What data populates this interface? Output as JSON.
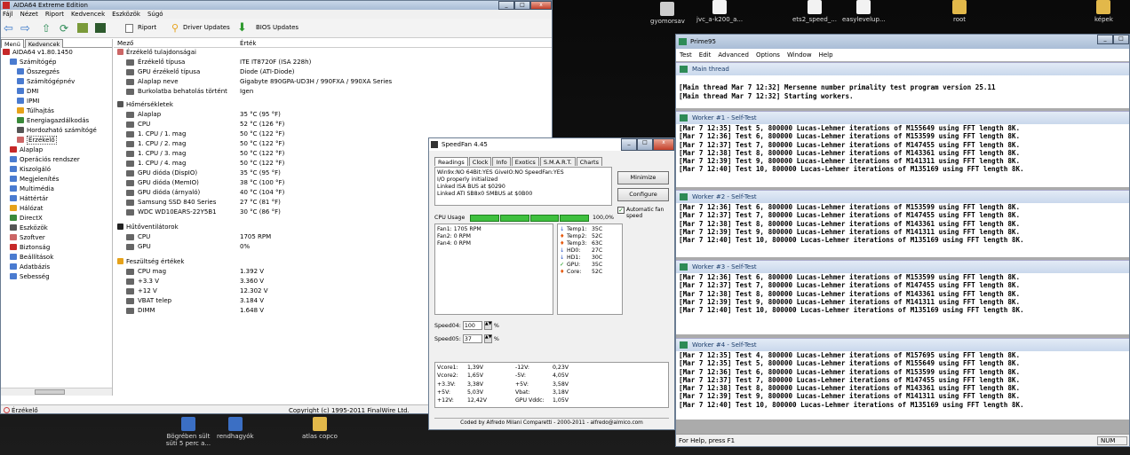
{
  "desktop": {
    "icons": [
      {
        "label": "gyomorsav",
        "icon": "app-icon"
      },
      {
        "label": "jvc_a-k200_a...",
        "icon": "document-icon"
      },
      {
        "label": "ets2_speed_...",
        "icon": "document-icon"
      },
      {
        "label": "easylevelup...",
        "icon": "document-icon"
      },
      {
        "label": "root",
        "icon": "folder-icon"
      },
      {
        "label": "képek",
        "icon": "folder-icon"
      },
      {
        "label": "Bögrében sült süti 5 perc a...",
        "icon": "word-icon"
      },
      {
        "label": "rendhagyók",
        "icon": "word-icon"
      },
      {
        "label": "atlas copco",
        "icon": "folder-icon"
      }
    ]
  },
  "aida": {
    "title": "AIDA64 Extreme Edition",
    "menu": [
      "Fájl",
      "Nézet",
      "Riport",
      "Kedvencek",
      "Eszközök",
      "Súgó"
    ],
    "toolbar": {
      "report": "Riport",
      "driver": "Driver Updates",
      "bios": "BIOS Updates"
    },
    "left_tabs": [
      "Menü",
      "Kedvencek"
    ],
    "tree": [
      {
        "label": "AIDA64 v1.80.1450",
        "level": 0
      },
      {
        "label": "Számítógép",
        "level": 1
      },
      {
        "label": "Összegzés",
        "level": 2
      },
      {
        "label": "Számítógépnév",
        "level": 2
      },
      {
        "label": "DMI",
        "level": 2
      },
      {
        "label": "IPMI",
        "level": 2
      },
      {
        "label": "Túlhajtás",
        "level": 2
      },
      {
        "label": "Energiagazdálkodás",
        "level": 2
      },
      {
        "label": "Hordozható számítógé",
        "level": 2
      },
      {
        "label": "Érzékelő",
        "level": 2
      },
      {
        "label": "Alaplap",
        "level": 1
      },
      {
        "label": "Operációs rendszer",
        "level": 1
      },
      {
        "label": "Kiszolgáló",
        "level": 1
      },
      {
        "label": "Megjelenítés",
        "level": 1
      },
      {
        "label": "Multimédia",
        "level": 1
      },
      {
        "label": "Háttértár",
        "level": 1
      },
      {
        "label": "Hálózat",
        "level": 1
      },
      {
        "label": "DirectX",
        "level": 1
      },
      {
        "label": "Eszközök",
        "level": 1
      },
      {
        "label": "Szoftver",
        "level": 1
      },
      {
        "label": "Biztonság",
        "level": 1
      },
      {
        "label": "Beállítások",
        "level": 1
      },
      {
        "label": "Adatbázis",
        "level": 1
      },
      {
        "label": "Sebesség",
        "level": 1
      }
    ],
    "columns": [
      "Mező",
      "Érték"
    ],
    "sections": [
      {
        "title": "Érzékelő tulajdonságai",
        "rows": [
          [
            "Érzékelő típusa",
            "ITE IT8720F  (ISA 228h)"
          ],
          [
            "GPU érzékelő típusa",
            "Diode  (ATI-Diode)"
          ],
          [
            "Alaplap neve",
            "Gigabyte 890GPA-UD3H / 990FXA / 990XA Series"
          ],
          [
            "Burkolatba behatolás történt",
            "Igen"
          ]
        ]
      },
      {
        "title": "Hőmérsékletek",
        "rows": [
          [
            "Alaplap",
            "35 °C  (95 °F)"
          ],
          [
            "CPU",
            "52 °C  (126 °F)"
          ],
          [
            "1. CPU / 1. mag",
            "50 °C  (122 °F)"
          ],
          [
            "1. CPU / 2. mag",
            "50 °C  (122 °F)"
          ],
          [
            "1. CPU / 3. mag",
            "50 °C  (122 °F)"
          ],
          [
            "1. CPU / 4. mag",
            "50 °C  (122 °F)"
          ],
          [
            "GPU dióda (DispIO)",
            "35 °C  (95 °F)"
          ],
          [
            "GPU dióda (MemIO)",
            "38 °C  (100 °F)"
          ],
          [
            "GPU dióda (árnyaló)",
            "40 °C  (104 °F)"
          ],
          [
            "Samsung SSD 840 Series",
            "27 °C  (81 °F)"
          ],
          [
            "WDC WD10EARS-22Y5B1",
            "30 °C  (86 °F)"
          ]
        ]
      },
      {
        "title": "Hűtőventilátorok",
        "rows": [
          [
            "CPU",
            "1705 RPM"
          ],
          [
            "GPU",
            "0%"
          ]
        ]
      },
      {
        "title": "Feszültség értékek",
        "rows": [
          [
            "CPU mag",
            "1.392 V"
          ],
          [
            "+3.3 V",
            "3.360 V"
          ],
          [
            "+12 V",
            "12.302 V"
          ],
          [
            "VBAT telep",
            "3.184 V"
          ],
          [
            "DIMM",
            "1.648 V"
          ]
        ]
      }
    ],
    "status_left": "Érzékelő",
    "status_right": "Copyright (c) 1995-2011 FinalWire Ltd."
  },
  "speedfan": {
    "title": "SpeedFan 4.45",
    "tabs": [
      "Readings",
      "Clock",
      "Info",
      "Exotics",
      "S.M.A.R.T.",
      "Charts"
    ],
    "log": [
      "Win9x:NO  64Bit:YES  GiveIO:NO  SpeedFan:YES",
      "I/O properly initialized",
      "Linked ISA BUS at $0290",
      "Linked ATI SB8x0 SMBUS at $0B00"
    ],
    "buttons": {
      "minimize": "Minimize",
      "configure": "Configure"
    },
    "autofan": "Automatic fan speed",
    "cpu_usage_label": "CPU Usage",
    "cpu_usage_pct": "100,0%",
    "fans": [
      "Fan1: 1705 RPM",
      "Fan2: 0 RPM",
      "Fan4: 0 RPM"
    ],
    "temps": [
      {
        "label": "Temp1:",
        "value": "35C",
        "status": "down"
      },
      {
        "label": "Temp2:",
        "value": "52C",
        "status": "hot"
      },
      {
        "label": "Temp3:",
        "value": "63C",
        "status": "hot"
      },
      {
        "label": "HD0:",
        "value": "27C",
        "status": "down"
      },
      {
        "label": "HD1:",
        "value": "30C",
        "status": "down"
      },
      {
        "label": "GPU:",
        "value": "35C",
        "status": "ok"
      },
      {
        "label": "Core:",
        "value": "52C",
        "status": "hot"
      }
    ],
    "speeds": [
      {
        "label": "Speed04:",
        "value": "100",
        "unit": "%"
      },
      {
        "label": "Speed05:",
        "value": "37",
        "unit": "%"
      }
    ],
    "volts": [
      [
        "Vcore1:",
        "1,39V",
        "-12V:",
        "0,23V"
      ],
      [
        "Vcore2:",
        "1,65V",
        "-5V:",
        "4,05V"
      ],
      [
        "+3.3V:",
        "3,38V",
        "+5V:",
        "3,58V"
      ],
      [
        "+5V:",
        "5,03V",
        "Vbat:",
        "3,18V"
      ],
      [
        "+12V:",
        "12,42V",
        "GPU Vddc:",
        "1,05V"
      ]
    ],
    "footer": "Coded by Alfredo Milani Comparetti - 2000-2011 - alfredo@almico.com"
  },
  "prime": {
    "title": "Prime95",
    "menu": [
      "Test",
      "Edit",
      "Advanced",
      "Options",
      "Window",
      "Help"
    ],
    "panes": [
      {
        "title": "Main thread",
        "lines": [
          "",
          "[Main thread Mar 7 12:32] Mersenne number primality test program version 25.11",
          "[Main thread Mar 7 12:32] Starting workers."
        ]
      },
      {
        "title": "Worker #1 - Self-Test",
        "lines": [
          "[Mar 7 12:35] Test 5, 800000 Lucas-Lehmer iterations of M155649 using FFT length 8K.",
          "[Mar 7 12:36] Test 6, 800000 Lucas-Lehmer iterations of M153599 using FFT length 8K.",
          "[Mar 7 12:37] Test 7, 800000 Lucas-Lehmer iterations of M147455 using FFT length 8K.",
          "[Mar 7 12:38] Test 8, 800000 Lucas-Lehmer iterations of M143361 using FFT length 8K.",
          "[Mar 7 12:39] Test 9, 800000 Lucas-Lehmer iterations of M141311 using FFT length 8K.",
          "[Mar 7 12:40] Test 10, 800000 Lucas-Lehmer iterations of M135169 using FFT length 8K."
        ]
      },
      {
        "title": "Worker #2 - Self-Test",
        "lines": [
          "[Mar 7 12:36] Test 6, 800000 Lucas-Lehmer iterations of M153599 using FFT length 8K.",
          "[Mar 7 12:37] Test 7, 800000 Lucas-Lehmer iterations of M147455 using FFT length 8K.",
          "[Mar 7 12:38] Test 8, 800000 Lucas-Lehmer iterations of M143361 using FFT length 8K.",
          "[Mar 7 12:39] Test 9, 800000 Lucas-Lehmer iterations of M141311 using FFT length 8K.",
          "[Mar 7 12:40] Test 10, 800000 Lucas-Lehmer iterations of M135169 using FFT length 8K."
        ]
      },
      {
        "title": "Worker #3 - Self-Test",
        "lines": [
          "[Mar 7 12:36] Test 6, 800000 Lucas-Lehmer iterations of M153599 using FFT length 8K.",
          "[Mar 7 12:37] Test 7, 800000 Lucas-Lehmer iterations of M147455 using FFT length 8K.",
          "[Mar 7 12:38] Test 8, 800000 Lucas-Lehmer iterations of M143361 using FFT length 8K.",
          "[Mar 7 12:39] Test 9, 800000 Lucas-Lehmer iterations of M141311 using FFT length 8K.",
          "[Mar 7 12:40] Test 10, 800000 Lucas-Lehmer iterations of M135169 using FFT length 8K."
        ]
      },
      {
        "title": "Worker #4 - Self-Test",
        "lines": [
          "[Mar 7 12:35] Test 4, 800000 Lucas-Lehmer iterations of M157695 using FFT length 8K.",
          "[Mar 7 12:35] Test 5, 800000 Lucas-Lehmer iterations of M155649 using FFT length 8K.",
          "[Mar 7 12:36] Test 6, 800000 Lucas-Lehmer iterations of M153599 using FFT length 8K.",
          "[Mar 7 12:37] Test 7, 800000 Lucas-Lehmer iterations of M147455 using FFT length 8K.",
          "[Mar 7 12:38] Test 8, 800000 Lucas-Lehmer iterations of M143361 using FFT length 8K.",
          "[Mar 7 12:39] Test 9, 800000 Lucas-Lehmer iterations of M141311 using FFT length 8K.",
          "[Mar 7 12:40] Test 10, 800000 Lucas-Lehmer iterations of M135169 using FFT length 8K."
        ]
      }
    ],
    "status_left": "For Help, press F1",
    "status_right": "NUM"
  }
}
